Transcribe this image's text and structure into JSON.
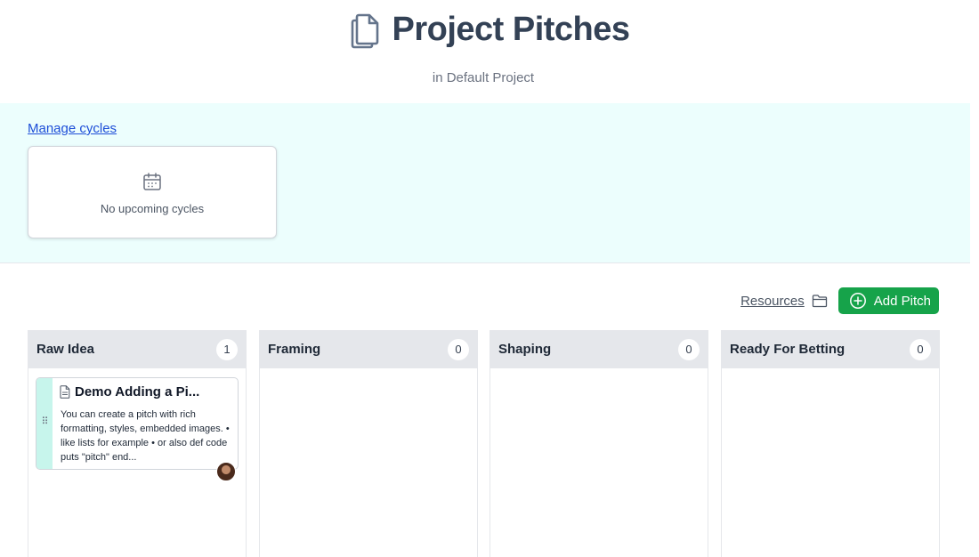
{
  "header": {
    "title": "Project Pitches",
    "title_icon": "documents-icon",
    "subtitle": "in Default Project"
  },
  "cycles": {
    "manage_label": "Manage cycles",
    "empty_text": "No upcoming cycles",
    "empty_icon": "calendar-icon"
  },
  "toolbar": {
    "resources_label": "Resources",
    "resources_icon": "folder-icon",
    "add_label": "Add Pitch",
    "add_icon": "plus-circle-icon"
  },
  "columns": [
    {
      "title": "Raw Idea",
      "count": "1"
    },
    {
      "title": "Framing",
      "count": "0"
    },
    {
      "title": "Shaping",
      "count": "0"
    },
    {
      "title": "Ready For Betting",
      "count": "0"
    }
  ],
  "pitch": {
    "title": "Demo Adding a Pi...",
    "body": "You can create a pitch with rich formatting, styles, embedded images.  • like lists for example • or also def code puts \"pitch\" end..."
  },
  "colors": {
    "accent_green": "#16a34a",
    "band_bg": "#ecfefd",
    "link_blue": "#1d4ed8",
    "card_stripe": "#c7f5ec"
  }
}
